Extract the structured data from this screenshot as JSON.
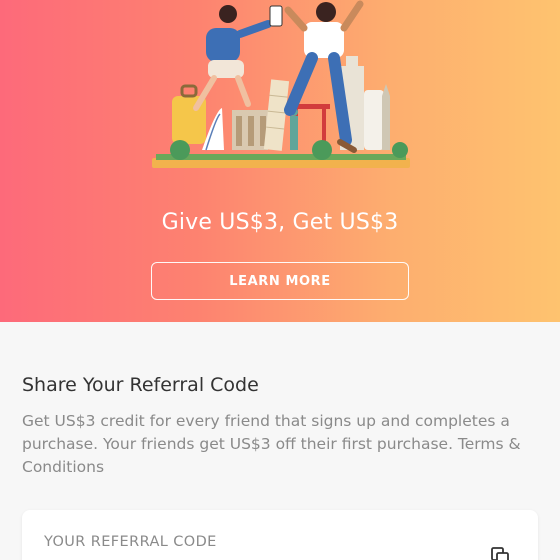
{
  "hero": {
    "headline": "Give US$3, Get US$3",
    "learn_more_label": "LEARN MORE",
    "gradient": [
      "#fd6a7a",
      "#fec36f"
    ]
  },
  "share": {
    "title": "Share Your Referral Code",
    "description": "Get US$3 credit for every friend that signs up and completes a purchase. Your friends get US$3 off their first purchase. Terms & Conditions"
  },
  "referral_card": {
    "label": "YOUR REFERRAL CODE",
    "copy_icon": "copy-icon"
  }
}
